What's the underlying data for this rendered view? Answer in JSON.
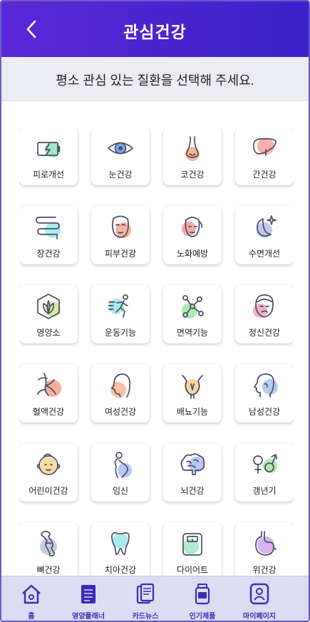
{
  "header": {
    "title": "관심건강"
  },
  "subtitle": "평소 관심 있는 질환을 선택해 주세요.",
  "categories": [
    {
      "label": "피로개선",
      "icon": "battery-icon",
      "accent": "#8fe0b8"
    },
    {
      "label": "눈건강",
      "icon": "eye-icon",
      "accent": "#7fa6e8"
    },
    {
      "label": "코건강",
      "icon": "nose-icon",
      "accent": "#f7a98a"
    },
    {
      "label": "간건강",
      "icon": "liver-icon",
      "accent": "#f7a0a0"
    },
    {
      "label": "장건강",
      "icon": "intestine-icon",
      "accent": "#9ee6ea"
    },
    {
      "label": "피부건강",
      "icon": "face-mask-icon",
      "accent": "#f6a98e"
    },
    {
      "label": "노화예방",
      "icon": "aging-face-icon",
      "accent": "#f59b9b"
    },
    {
      "label": "수면개선",
      "icon": "moon-stars-icon",
      "accent": "#b6bfe8"
    },
    {
      "label": "영양소",
      "icon": "leaf-hexagon-icon",
      "accent": "#cde89a"
    },
    {
      "label": "운동기능",
      "icon": "runner-icon",
      "accent": "#9ee6ea"
    },
    {
      "label": "면역기능",
      "icon": "molecule-icon",
      "accent": "#a6e3a6"
    },
    {
      "label": "정신건강",
      "icon": "sad-face-icon",
      "accent": "#f7a3b8"
    },
    {
      "label": "혈액건강",
      "icon": "blood-vessel-icon",
      "accent": "#f4a08f"
    },
    {
      "label": "여성건강",
      "icon": "woman-profile-icon",
      "accent": "#f8b894"
    },
    {
      "label": "배뇨기능",
      "icon": "bladder-icon",
      "accent": "#f8cf8f"
    },
    {
      "label": "남성건강",
      "icon": "man-profile-icon",
      "accent": "#a9c1ee"
    },
    {
      "label": "어린이건강",
      "icon": "baby-face-icon",
      "accent": "#f8d48f"
    },
    {
      "label": "임신",
      "icon": "pregnant-icon",
      "accent": "#a9bff0"
    },
    {
      "label": "뇌건강",
      "icon": "brain-icon",
      "accent": "#a9c1ee"
    },
    {
      "label": "갱년기",
      "icon": "gender-symbols-icon",
      "accent": "#a6e3a6"
    },
    {
      "label": "뼈건강",
      "icon": "bone-joint-icon",
      "accent": "#b8c4d8"
    },
    {
      "label": "치아건강",
      "icon": "tooth-icon",
      "accent": "#9ee6ea"
    },
    {
      "label": "다이어트",
      "icon": "scale-icon",
      "accent": "#a6e6c8"
    },
    {
      "label": "위건강",
      "icon": "stomach-icon",
      "accent": "#d2a6ee"
    }
  ],
  "tabs": [
    {
      "label": "홈",
      "icon": "home-icon"
    },
    {
      "label": "영양플래너",
      "icon": "planner-icon"
    },
    {
      "label": "카드뉴스",
      "icon": "card-news-icon"
    },
    {
      "label": "인기제품",
      "icon": "product-bottle-icon"
    },
    {
      "label": "마이페이지",
      "icon": "profile-icon"
    }
  ],
  "colors": {
    "header": "#4a25cf",
    "tab_accent": "#3a2bb8",
    "line": "#4a4f66"
  }
}
